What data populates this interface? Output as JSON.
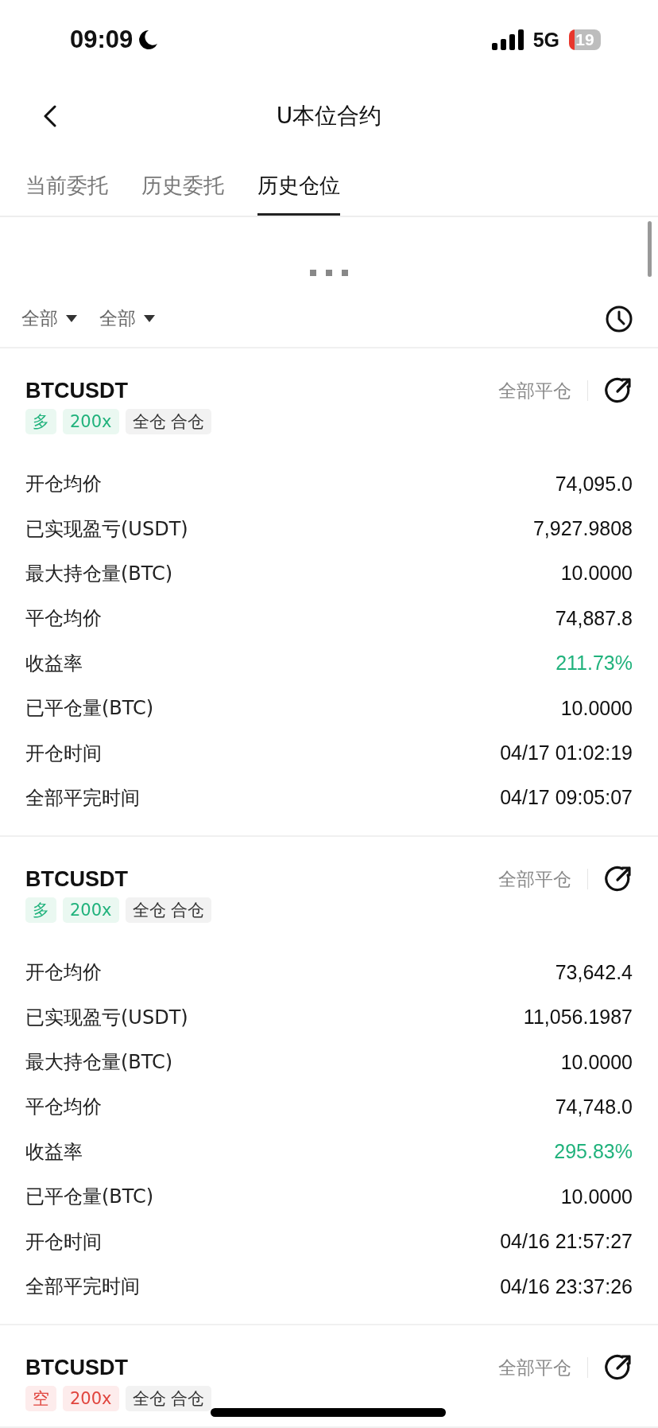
{
  "status_bar": {
    "time": "09:09",
    "network": "5G",
    "battery": "19"
  },
  "nav": {
    "title": "U本位合约"
  },
  "tabs": [
    {
      "label": "当前委托",
      "selected": false
    },
    {
      "label": "历史委托",
      "selected": false
    },
    {
      "label": "历史仓位",
      "selected": true
    }
  ],
  "filters": [
    {
      "label": "全部"
    },
    {
      "label": "全部"
    }
  ],
  "positions": [
    {
      "symbol": "BTCUSDT",
      "kind": "long",
      "side_label": "多",
      "leverage": "200x",
      "margin_tag": "全仓 合仓",
      "action": "全部平仓",
      "rows": [
        {
          "label": "开仓均价",
          "value": "74,095.0",
          "kind": "plain"
        },
        {
          "label": "已实现盈亏(USDT)",
          "value": "7,927.9808",
          "kind": "plain"
        },
        {
          "label": "最大持仓量(BTC)",
          "value": "10.0000",
          "kind": "plain"
        },
        {
          "label": "平仓均价",
          "value": "74,887.8",
          "kind": "plain"
        },
        {
          "label": "收益率",
          "value": "211.73%",
          "kind": "gain"
        },
        {
          "label": "已平仓量(BTC)",
          "value": "10.0000",
          "kind": "plain"
        },
        {
          "label": "开仓时间",
          "value": "04/17 01:02:19",
          "kind": "plain"
        },
        {
          "label": "全部平完时间",
          "value": "04/17 09:05:07",
          "kind": "plain"
        }
      ]
    },
    {
      "symbol": "BTCUSDT",
      "kind": "long",
      "side_label": "多",
      "leverage": "200x",
      "margin_tag": "全仓 合仓",
      "action": "全部平仓",
      "rows": [
        {
          "label": "开仓均价",
          "value": "73,642.4",
          "kind": "plain"
        },
        {
          "label": "已实现盈亏(USDT)",
          "value": "11,056.1987",
          "kind": "plain"
        },
        {
          "label": "最大持仓量(BTC)",
          "value": "10.0000",
          "kind": "plain"
        },
        {
          "label": "平仓均价",
          "value": "74,748.0",
          "kind": "plain"
        },
        {
          "label": "收益率",
          "value": "295.83%",
          "kind": "gain"
        },
        {
          "label": "已平仓量(BTC)",
          "value": "10.0000",
          "kind": "plain"
        },
        {
          "label": "开仓时间",
          "value": "04/16 21:57:27",
          "kind": "plain"
        },
        {
          "label": "全部平完时间",
          "value": "04/16 23:37:26",
          "kind": "plain"
        }
      ]
    },
    {
      "symbol": "BTCUSDT",
      "kind": "short",
      "side_label": "空",
      "leverage": "200x",
      "margin_tag": "全仓 合仓",
      "action": "全部平仓"
    }
  ]
}
